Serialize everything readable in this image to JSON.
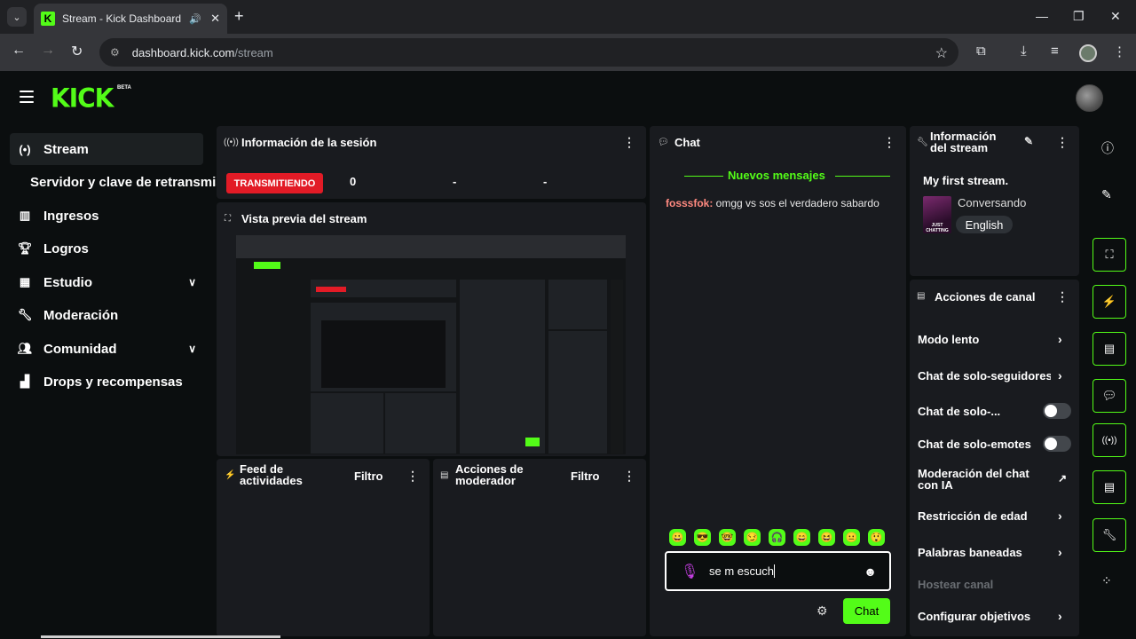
{
  "browser": {
    "tab_title": "Stream - Kick Dashboard",
    "url_host": "dashboard.kick.com",
    "url_path": "/stream"
  },
  "header": {
    "logo": "KICK",
    "beta": "BETA"
  },
  "sidebar": {
    "items": [
      {
        "label": "Stream",
        "icon": "broadcast-icon"
      },
      {
        "label": "Ingresos",
        "icon": "chart-icon"
      },
      {
        "label": "Logros",
        "icon": "trophy-icon"
      },
      {
        "label": "Estudio",
        "icon": "studio-icon"
      },
      {
        "label": "Moderación",
        "icon": "wrench-icon"
      },
      {
        "label": "Comunidad",
        "icon": "users-icon"
      },
      {
        "label": "Drops y recompensas",
        "icon": "drops-icon"
      }
    ],
    "subitem": "Servidor y clave de retransmisión"
  },
  "session": {
    "title": "Información de la sesión",
    "status": "TRANSMITIENDO",
    "viewers": "0",
    "stat2": "-",
    "stat3": "-"
  },
  "preview": {
    "title": "Vista previa del stream"
  },
  "activity": {
    "title_line1": "Feed de",
    "title_line2": "actividades",
    "filter": "Filtro"
  },
  "modactions": {
    "title_line1": "Acciones de",
    "title_line2": "moderador",
    "filter": "Filtro"
  },
  "chat": {
    "title": "Chat",
    "new_messages": "Nuevos mensajes",
    "messages": [
      {
        "user": "fosssfok:",
        "text": " omgg vs sos el verdadero sabardo"
      }
    ],
    "input_value": "se m escuch",
    "send_label": "Chat",
    "emotes": [
      "😀",
      "😎",
      "🤓",
      "😏",
      "🎧",
      "😄",
      "😆",
      "😐",
      "😲"
    ]
  },
  "stream_info": {
    "title_line1": "Información",
    "title_line2": "del stream",
    "stream_title": "My first stream.",
    "category": "Conversando",
    "category_thumb": "JUST CHATTING",
    "language": "English"
  },
  "channel_actions": {
    "title": "Acciones de canal",
    "items": [
      {
        "label": "Modo lento",
        "control": "chevron"
      },
      {
        "label": "Chat de solo-seguidores",
        "control": "chevron"
      },
      {
        "label": "Chat de solo-...",
        "control": "toggle",
        "on": false
      },
      {
        "label": "Chat de solo-emotes",
        "control": "toggle",
        "on": false
      },
      {
        "label": "Moderación del chat con IA",
        "control": "external"
      },
      {
        "label": "Restricción de edad",
        "control": "chevron"
      },
      {
        "label": "Palabras baneadas",
        "control": "chevron"
      },
      {
        "label": "Hostear canal",
        "control": "disabled"
      },
      {
        "label": "Configurar objetivos",
        "control": "chevron"
      }
    ]
  },
  "colors": {
    "brand": "#53fc18",
    "live": "#e21b26",
    "panel": "#191b1f",
    "background": "#0b0e0f"
  }
}
